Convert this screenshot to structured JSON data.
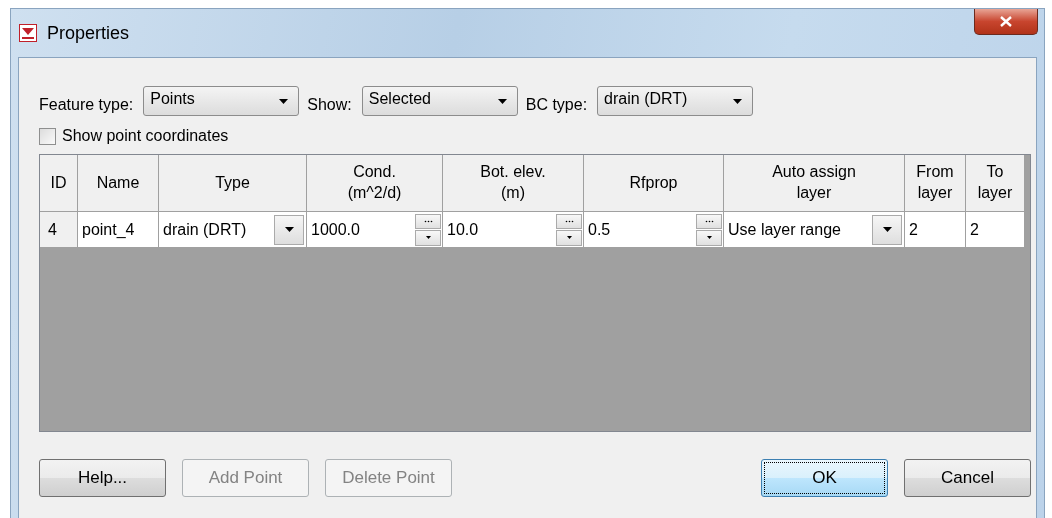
{
  "window": {
    "title": "Properties"
  },
  "filters": [
    {
      "label": "Feature type:",
      "value": "Points"
    },
    {
      "label": "Show:",
      "value": "Selected"
    },
    {
      "label": "BC type:",
      "value": "drain (DRT)"
    }
  ],
  "show_point_coordinates": {
    "label": "Show point coordinates",
    "checked": false
  },
  "table": {
    "columns": [
      "ID",
      "Name",
      "Type",
      "Cond.\n(m^2/d)",
      "Bot. elev.\n(m)",
      "Rfprop",
      "Auto assign\nlayer",
      "From\nlayer",
      "To\nlayer"
    ],
    "rows": [
      [
        {
          "kind": "id",
          "value": "4"
        },
        {
          "kind": "text",
          "value": "point_4"
        },
        {
          "kind": "dropdown",
          "value": "drain (DRT)"
        },
        {
          "kind": "spinner",
          "value": "1000.0"
        },
        {
          "kind": "spinner",
          "value": "10.0"
        },
        {
          "kind": "spinner",
          "value": "0.5"
        },
        {
          "kind": "dropdown",
          "value": "Use layer range"
        },
        {
          "kind": "text",
          "value": "2"
        },
        {
          "kind": "text",
          "value": "2"
        }
      ]
    ]
  },
  "buttons": [
    {
      "label": "Help...",
      "disabled": false,
      "default": false
    },
    {
      "label": "Add Point",
      "disabled": true,
      "default": false
    },
    {
      "label": "Delete Point",
      "disabled": true,
      "default": false
    },
    {
      "label": "OK",
      "disabled": false,
      "default": true
    },
    {
      "label": "Cancel",
      "disabled": false,
      "default": false
    }
  ]
}
